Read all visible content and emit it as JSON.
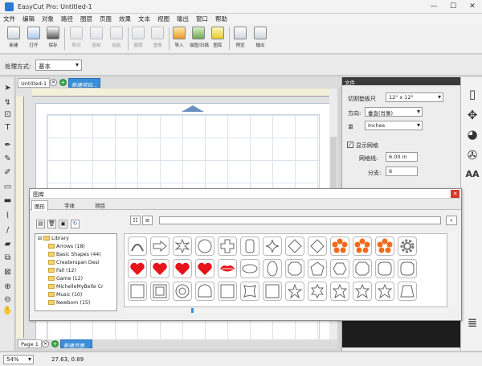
{
  "window": {
    "title": "EasyCut Pro: Untitled-1",
    "minimize": "—",
    "maximize": "☐",
    "close": "✕"
  },
  "menu": [
    "文件",
    "编辑",
    "对象",
    "路径",
    "图层",
    "页面",
    "效果",
    "文本",
    "视图",
    "输出",
    "窗口",
    "帮助"
  ],
  "toolbar": {
    "new": "新建",
    "open": "打开",
    "save": "保存",
    "cut": "剪切",
    "copy": "复制",
    "paste": "粘贴",
    "undo": "撤销",
    "redo": "重做",
    "import": "导入",
    "trace": "描图/扫描",
    "library": "图库",
    "preview": "预览",
    "output": "输出"
  },
  "processing": {
    "label": "处理方式:",
    "value": "基本"
  },
  "doc_tabs": {
    "doc1": "Untitled-1",
    "new_project": "新建项目..."
  },
  "page_tabs": {
    "page1": "Page 1",
    "new_page": "新建页面..."
  },
  "file_panel": {
    "header": "文件",
    "mat_size_label": "切割垫板尺",
    "mat_size_value": "12\" x 12\"",
    "orientation_label": "方向:",
    "orientation_value": "垂直(肖像)",
    "unit_label": "单",
    "unit_value": "Inches",
    "show_grid_label": "显示网格",
    "grid_spacing_label": "网格线:",
    "grid_spacing_value": "6.00 in",
    "subdivisions_label": "分支:",
    "subdivisions_value": "6"
  },
  "library": {
    "title": "图库",
    "tabs": [
      "图形",
      "字体",
      "项目"
    ],
    "tree": [
      "Library",
      "Arrows (18)",
      "Basic Shapes (44)",
      "Createrspan Desi",
      "Fall (12)",
      "Game (12)",
      "MichelleMyBelle Cr",
      "Music (10)",
      "Newborn (15)"
    ]
  },
  "status": {
    "zoom": "54%",
    "coords": "27.63, 0.89"
  },
  "colors": {
    "heart": "#e8141b",
    "flower": "#f26b1d",
    "accent_blue": "#3a8fd8"
  }
}
